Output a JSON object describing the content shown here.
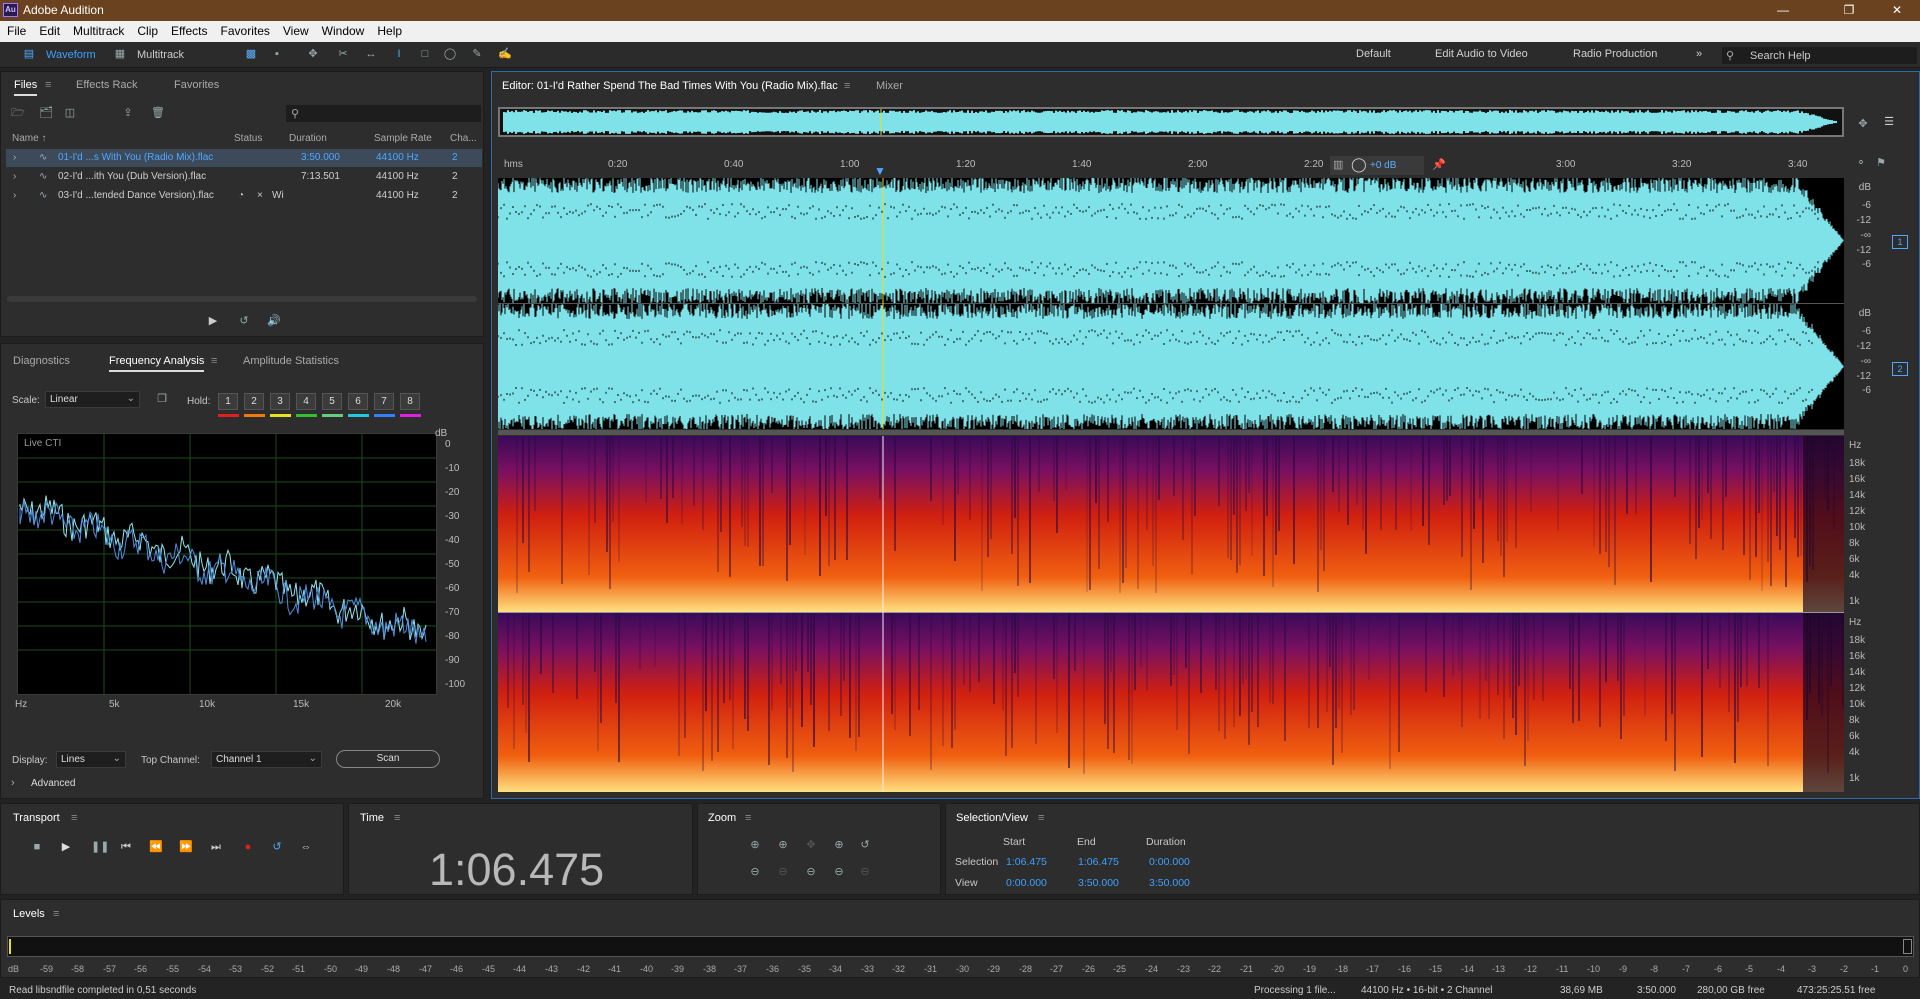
{
  "app": {
    "title": "Adobe Audition",
    "logo": "Au"
  },
  "menu": [
    "File",
    "Edit",
    "Multitrack",
    "Clip",
    "Effects",
    "Favorites",
    "View",
    "Window",
    "Help"
  ],
  "toolbar": {
    "waveform": "Waveform",
    "multitrack": "Multitrack",
    "workspaces": [
      "Default",
      "Edit Audio to Video",
      "Radio Production"
    ],
    "search_placeholder": "Search Help"
  },
  "files_panel": {
    "tabs": [
      "Files",
      "Effects Rack",
      "Favorites"
    ],
    "columns": [
      "Name ↑",
      "Status",
      "Duration",
      "Sample Rate",
      "Cha..."
    ],
    "rows": [
      {
        "name": "01-I'd ...s With You (Radio Mix).flac",
        "status": "",
        "duration": "3:50.000",
        "rate": "44100 Hz",
        "ch": "2"
      },
      {
        "name": "02-I'd ...ith You (Dub Version).flac",
        "status": "",
        "duration": "7:13.501",
        "rate": "44100 Hz",
        "ch": "2"
      },
      {
        "name": "03-I'd ...tended Dance Version).flac",
        "status": "Wi",
        "duration": "",
        "rate": "44100 Hz",
        "ch": "2"
      }
    ]
  },
  "analysis_panel": {
    "tabs": [
      "Diagnostics",
      "Frequency Analysis",
      "Amplitude Statistics"
    ],
    "scale_label": "Scale:",
    "scale_value": "Linear",
    "hold_label": "Hold:",
    "hold": [
      "1",
      "2",
      "3",
      "4",
      "5",
      "6",
      "7",
      "8"
    ],
    "hold_colors": [
      "#e02020",
      "#f07a10",
      "#e8e020",
      "#30c030",
      "#60d080",
      "#20c8e0",
      "#3080ff",
      "#e020e0"
    ],
    "graph_label": "Live CTI",
    "db_unit": "dB",
    "db_ticks": [
      "0",
      "-10",
      "-20",
      "-30",
      "-40",
      "-50",
      "-60",
      "-70",
      "-80",
      "-90",
      "-100"
    ],
    "hz_ticks": [
      "Hz",
      "5k",
      "10k",
      "15k",
      "20k"
    ],
    "display_label": "Display:",
    "display_value": "Lines",
    "top_channel_label": "Top Channel:",
    "top_channel_value": "Channel 1",
    "scan": "Scan",
    "advanced": "Advanced"
  },
  "editor": {
    "tab": "Editor: 01-I'd Rather Spend The Bad Times With You (Radio Mix).flac",
    "mixer": "Mixer",
    "ruler": [
      "hms",
      "0:20",
      "0:40",
      "1:00",
      "1:20",
      "1:40",
      "2:00",
      "2:20",
      "3:00",
      "3:20",
      "3:40"
    ],
    "volume": "+0 dB",
    "db_scale": [
      "dB",
      "-6",
      "-12",
      "-∞",
      "-12",
      "-6"
    ],
    "channels": [
      "1",
      "2"
    ],
    "hz_scale": [
      "Hz",
      "18k",
      "16k",
      "14k",
      "12k",
      "10k",
      "8k",
      "6k",
      "4k",
      "1k"
    ]
  },
  "transport": {
    "title": "Transport"
  },
  "time": {
    "title": "Time",
    "value": "1:06.475"
  },
  "zoom": {
    "title": "Zoom"
  },
  "selection": {
    "title": "Selection/View",
    "headers": [
      "Start",
      "End",
      "Duration"
    ],
    "rows": [
      {
        "label": "Selection",
        "start": "1:06.475",
        "end": "1:06.475",
        "dur": "0:00.000"
      },
      {
        "label": "View",
        "start": "0:00.000",
        "end": "3:50.000",
        "dur": "3:50.000"
      }
    ]
  },
  "levels": {
    "title": "Levels",
    "ticks": [
      "dB",
      "-59",
      "-58",
      "-57",
      "-56",
      "-55",
      "-54",
      "-53",
      "-52",
      "-51",
      "-50",
      "-49",
      "-48",
      "-47",
      "-46",
      "-45",
      "-44",
      "-43",
      "-42",
      "-41",
      "-40",
      "-39",
      "-38",
      "-37",
      "-36",
      "-35",
      "-34",
      "-33",
      "-32",
      "-31",
      "-30",
      "-29",
      "-28",
      "-27",
      "-26",
      "-25",
      "-24",
      "-23",
      "-22",
      "-21",
      "-20",
      "-19",
      "-18",
      "-17",
      "-16",
      "-15",
      "-14",
      "-13",
      "-12",
      "-11",
      "-10",
      "-9",
      "-8",
      "-7",
      "-6",
      "-5",
      "-4",
      "-3",
      "-2",
      "-1",
      "0"
    ]
  },
  "status": {
    "message": "Read libsndfile completed in 0,51 seconds",
    "processing": "Processing 1 file...",
    "format": "44100 Hz • 16-bit • 2 Channel",
    "size": "38,69 MB",
    "duration": "3:50.000",
    "free": "280,00 GB free",
    "free_time": "473:25:25.51 free"
  }
}
